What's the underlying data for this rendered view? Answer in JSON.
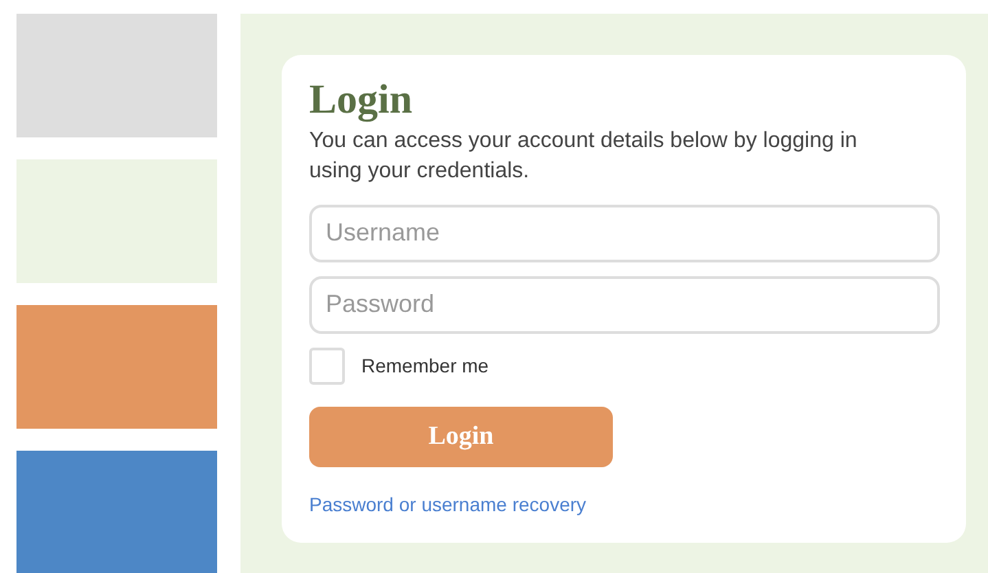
{
  "sidebar": {
    "blocks": [
      {
        "color": "#dedede"
      },
      {
        "color": "#edf4e4"
      },
      {
        "color": "#e39660"
      },
      {
        "color": "#4d87c6"
      }
    ]
  },
  "login": {
    "title": "Login",
    "description": "You can access your account details below by logging in using your credentials.",
    "fields": [
      {
        "placeholder": "Username"
      },
      {
        "placeholder": "Password"
      }
    ],
    "remember": {
      "label": "Remember me",
      "checked": false
    },
    "button": "Login",
    "link": "Password or username recovery"
  }
}
